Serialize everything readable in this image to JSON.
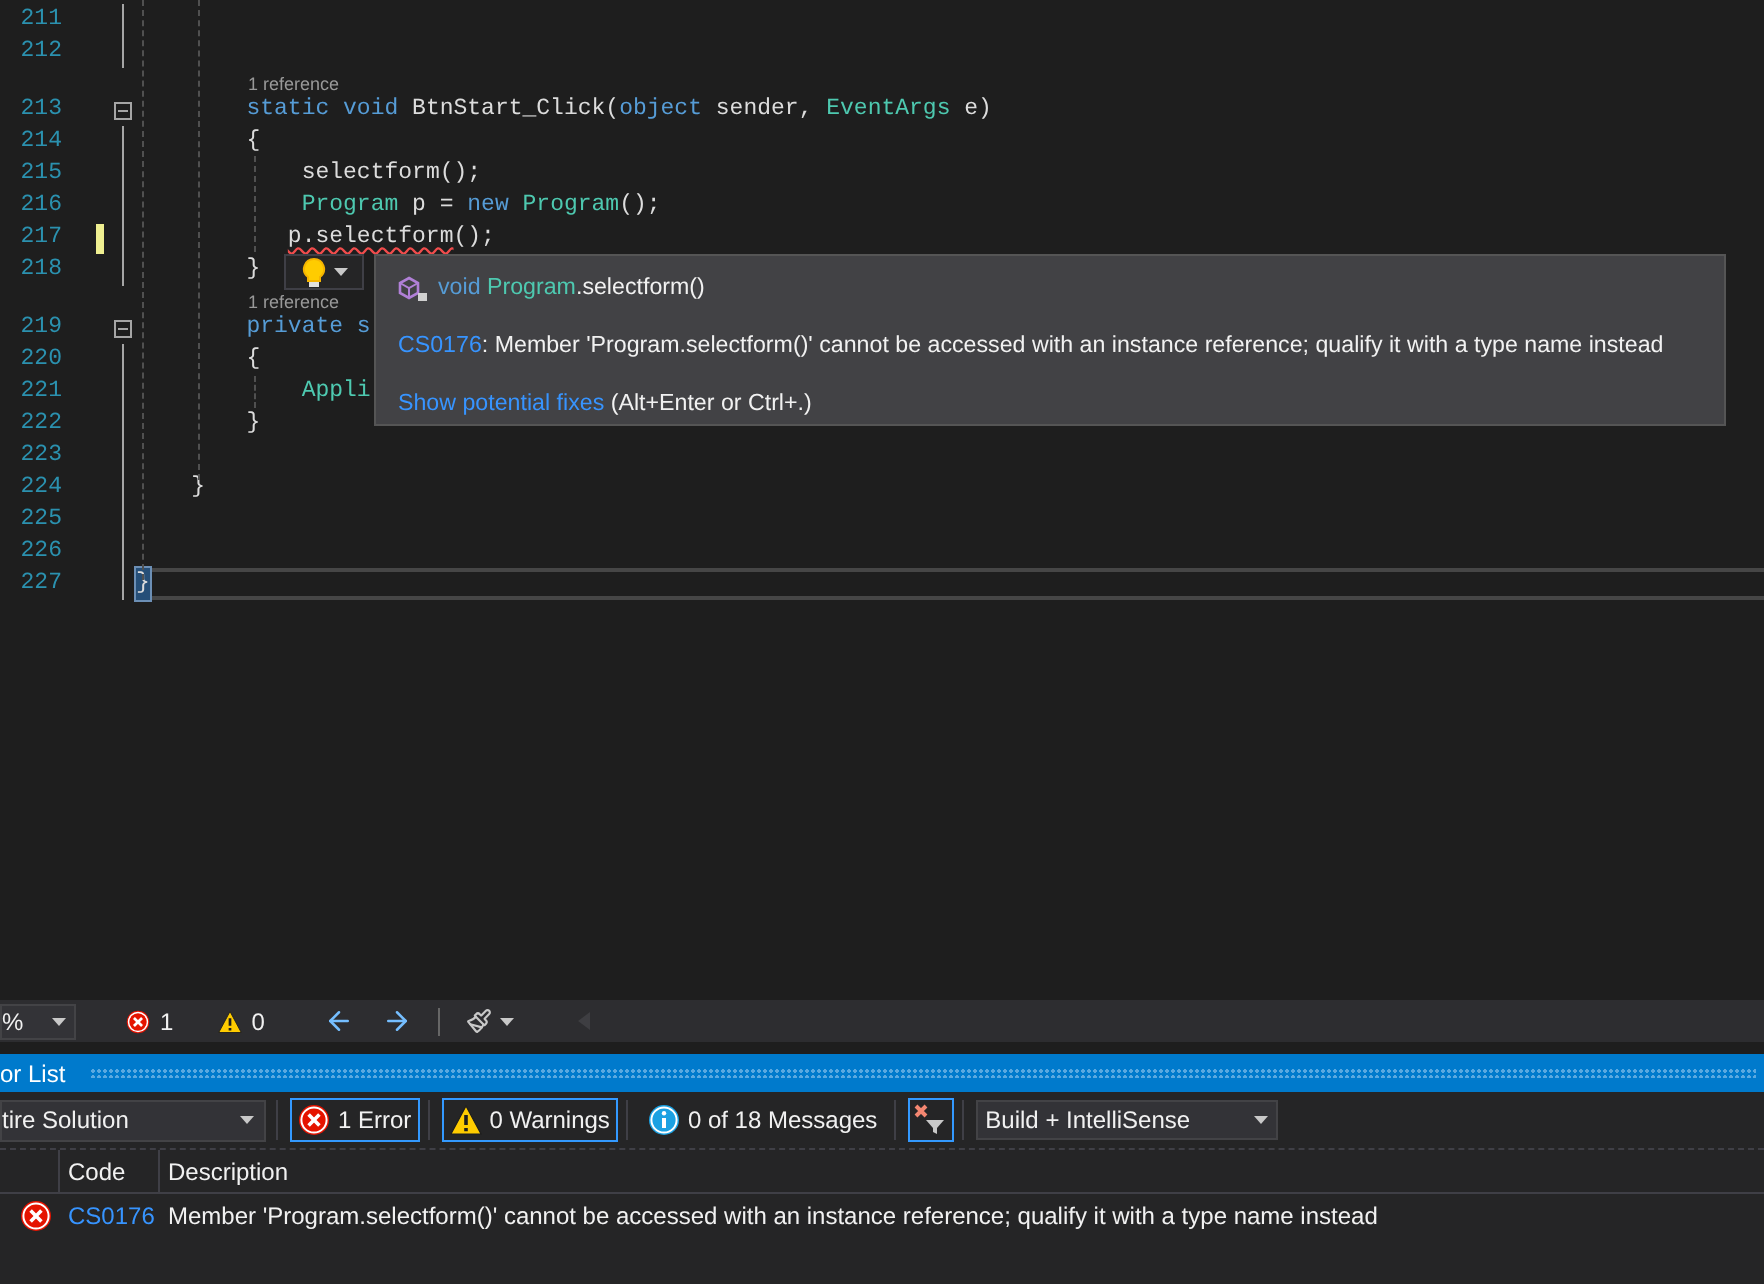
{
  "editor": {
    "lines": [
      {
        "number": "211"
      },
      {
        "number": "212"
      },
      {
        "number": "213",
        "lens": "1 reference",
        "fold": true,
        "tokens": [
          {
            "text": "        static void",
            "kind": "keyword"
          },
          {
            "text": " BtnStart_Click(",
            "kind": "plain"
          },
          {
            "text": "object",
            "kind": "keyword"
          },
          {
            "text": " sender, ",
            "kind": "plain"
          },
          {
            "text": "EventArgs",
            "kind": "type"
          },
          {
            "text": " e)",
            "kind": "plain"
          }
        ]
      },
      {
        "number": "214",
        "tokens": [
          {
            "text": "        {",
            "kind": "plain"
          }
        ]
      },
      {
        "number": "215",
        "tokens": [
          {
            "text": "            selectform();",
            "kind": "plain"
          }
        ]
      },
      {
        "number": "216",
        "tokens": [
          {
            "text": "            Program",
            "kind": "type"
          },
          {
            "text": " p = ",
            "kind": "plain"
          },
          {
            "text": "new ",
            "kind": "keyword"
          },
          {
            "text": "Program",
            "kind": "type"
          },
          {
            "text": "();",
            "kind": "plain"
          }
        ]
      },
      {
        "number": "217",
        "changed": true,
        "tokens": [
          {
            "text": "           p.selectform",
            "kind": "plain",
            "error": true
          },
          {
            "text": "();",
            "kind": "plain"
          }
        ]
      },
      {
        "number": "218",
        "tokens": [
          {
            "text": "        }",
            "kind": "plain"
          }
        ]
      },
      {
        "number": "219",
        "lens": "1 reference",
        "fold": true,
        "tokens": [
          {
            "text": "        private s",
            "kind": "keyword"
          }
        ]
      },
      {
        "number": "220",
        "tokens": [
          {
            "text": "        {",
            "kind": "plain"
          }
        ]
      },
      {
        "number": "221",
        "tokens": [
          {
            "text": "            Appli",
            "kind": "type"
          }
        ]
      },
      {
        "number": "222",
        "tokens": [
          {
            "text": "        }",
            "kind": "plain"
          }
        ]
      },
      {
        "number": "223"
      },
      {
        "number": "224",
        "tokens": [
          {
            "text": "    }",
            "kind": "plain"
          }
        ]
      },
      {
        "number": "225"
      },
      {
        "number": "226"
      },
      {
        "number": "227",
        "current": true,
        "tokens": [
          {
            "text": "}",
            "kind": "plain",
            "matched": true
          }
        ]
      }
    ],
    "tooltip": {
      "signature": [
        {
          "text": "void ",
          "kind": "keyword"
        },
        {
          "text": "Program",
          "kind": "type"
        },
        {
          "text": ".selectform()",
          "kind": "plain"
        }
      ],
      "error_code": "CS0176",
      "message": ": Member 'Program.selectform()' cannot be accessed with an instance reference; qualify it with a type name instead",
      "fixes_link": "Show potential fixes",
      "fixes_hint": " (Alt+Enter or Ctrl+.)"
    }
  },
  "status_strip": {
    "zoom": "%",
    "errors": "1",
    "warnings": "0"
  },
  "error_list": {
    "title": "or List",
    "scope": "tire Solution",
    "filters": [
      {
        "label": "1 Error",
        "kind": "error",
        "selected": true
      },
      {
        "label": "0 Warnings",
        "kind": "warning",
        "selected": true
      },
      {
        "label": "0 of 18 Messages",
        "kind": "info",
        "selected": false
      }
    ],
    "filter_toggle": {
      "on": true
    },
    "source": "Build + IntelliSense",
    "columns": [
      "Code",
      "Description"
    ],
    "rows": [
      {
        "kind": "error",
        "code": "CS0176",
        "description": "Member 'Program.selectform()' cannot be accessed with an instance reference; qualify it with a type name instead"
      }
    ]
  }
}
